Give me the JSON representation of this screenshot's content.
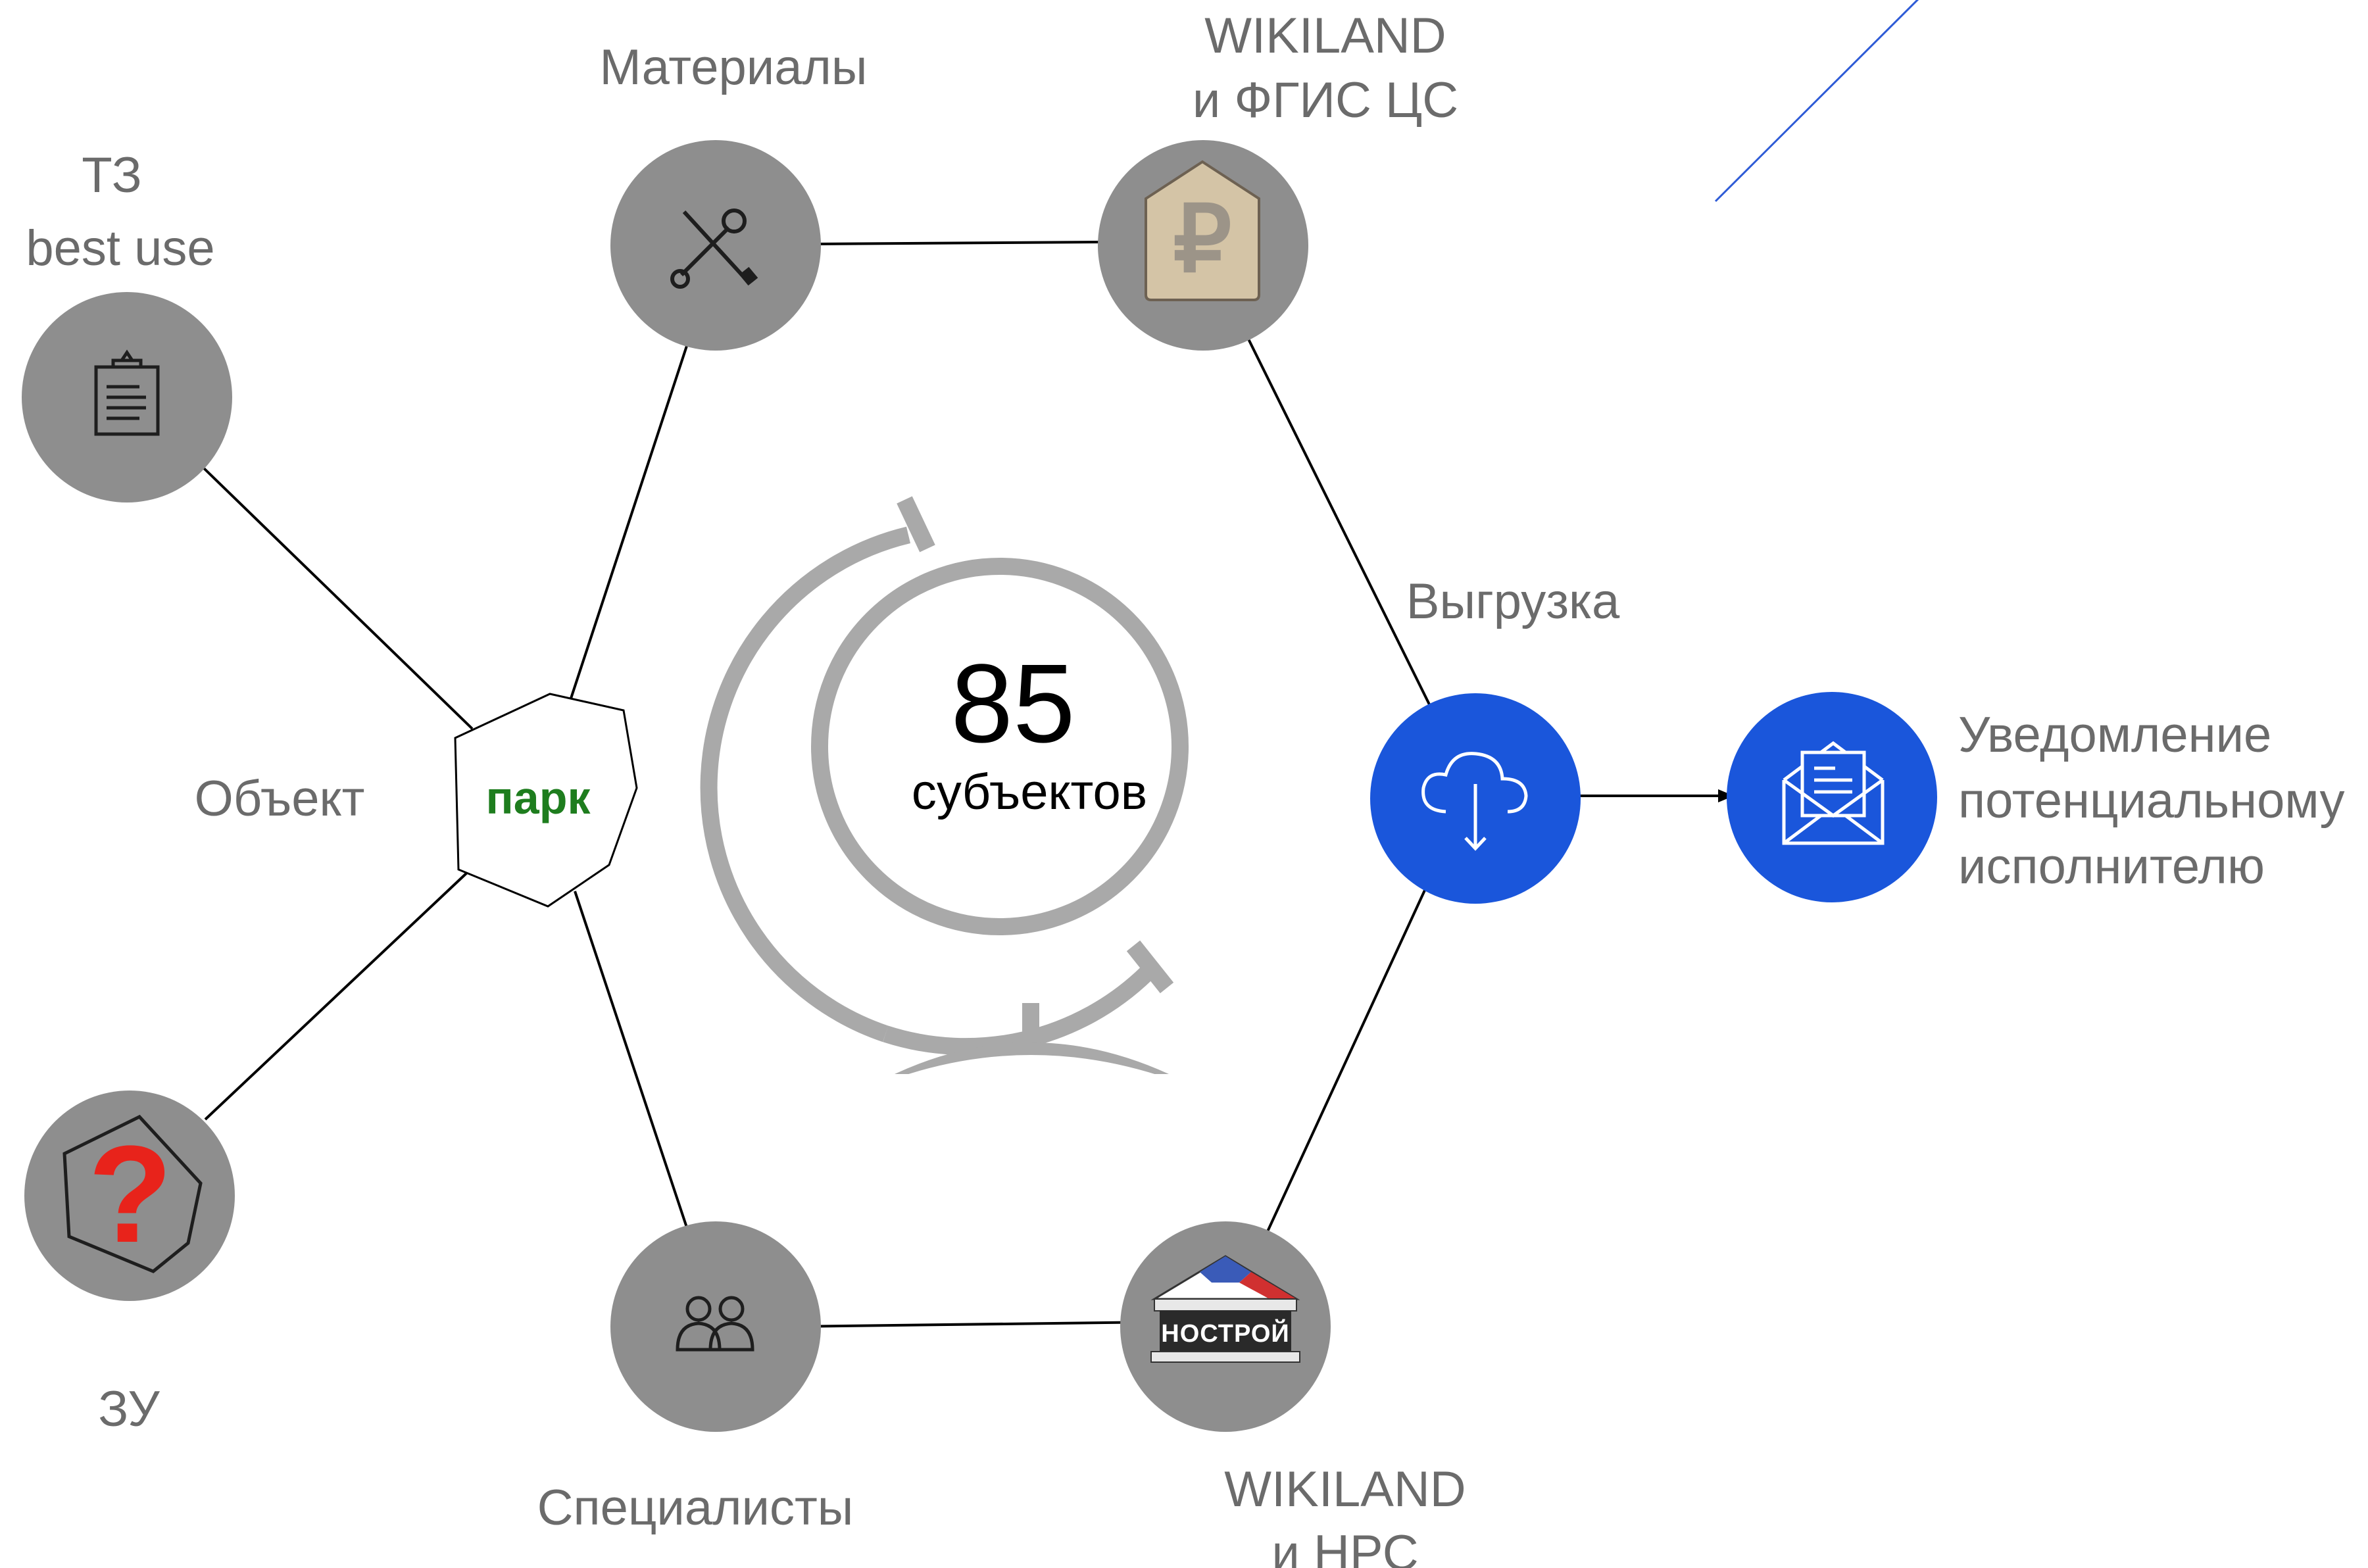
{
  "nodes": {
    "tz": {
      "line1": "ТЗ",
      "line2": "best use",
      "icon": "clipboard-icon"
    },
    "materials": {
      "label": "Материалы",
      "icon": "tools-icon"
    },
    "wikiland_fgis": {
      "line1": "WIKILAND",
      "line2": "и ФГИС ЦС",
      "icon": "ruble-house-icon",
      "icon_text": "₽"
    },
    "object": {
      "label": "Объект",
      "center_text": "парк"
    },
    "zu": {
      "label": "ЗУ",
      "icon": "question-icon",
      "icon_text": "?"
    },
    "specialists": {
      "label": "Специалисты",
      "icon": "people-icon"
    },
    "wikiland_nrs": {
      "line1": "WIKILAND",
      "line2": "и НРС",
      "icon": "nostroy-logo-icon",
      "icon_text": "НОСТРОЙ"
    },
    "upload": {
      "label": "Выгрузка",
      "icon": "cloud-download-icon"
    },
    "notify": {
      "line1": "Уведомление",
      "line2": "потенциальному",
      "line3": "исполнителю",
      "icon": "envelope-icon"
    }
  },
  "globe": {
    "number": "85",
    "caption": "субъектов",
    "icon": "globe-icon"
  },
  "colors": {
    "node_gray": "#8e8e8e",
    "accent_blue": "#1a56db",
    "label_gray": "#6b6b6b",
    "park_green": "#1e7d1e",
    "question_red": "#e8231b",
    "edge": "#000000",
    "deco_line": "#2e5bd6"
  }
}
